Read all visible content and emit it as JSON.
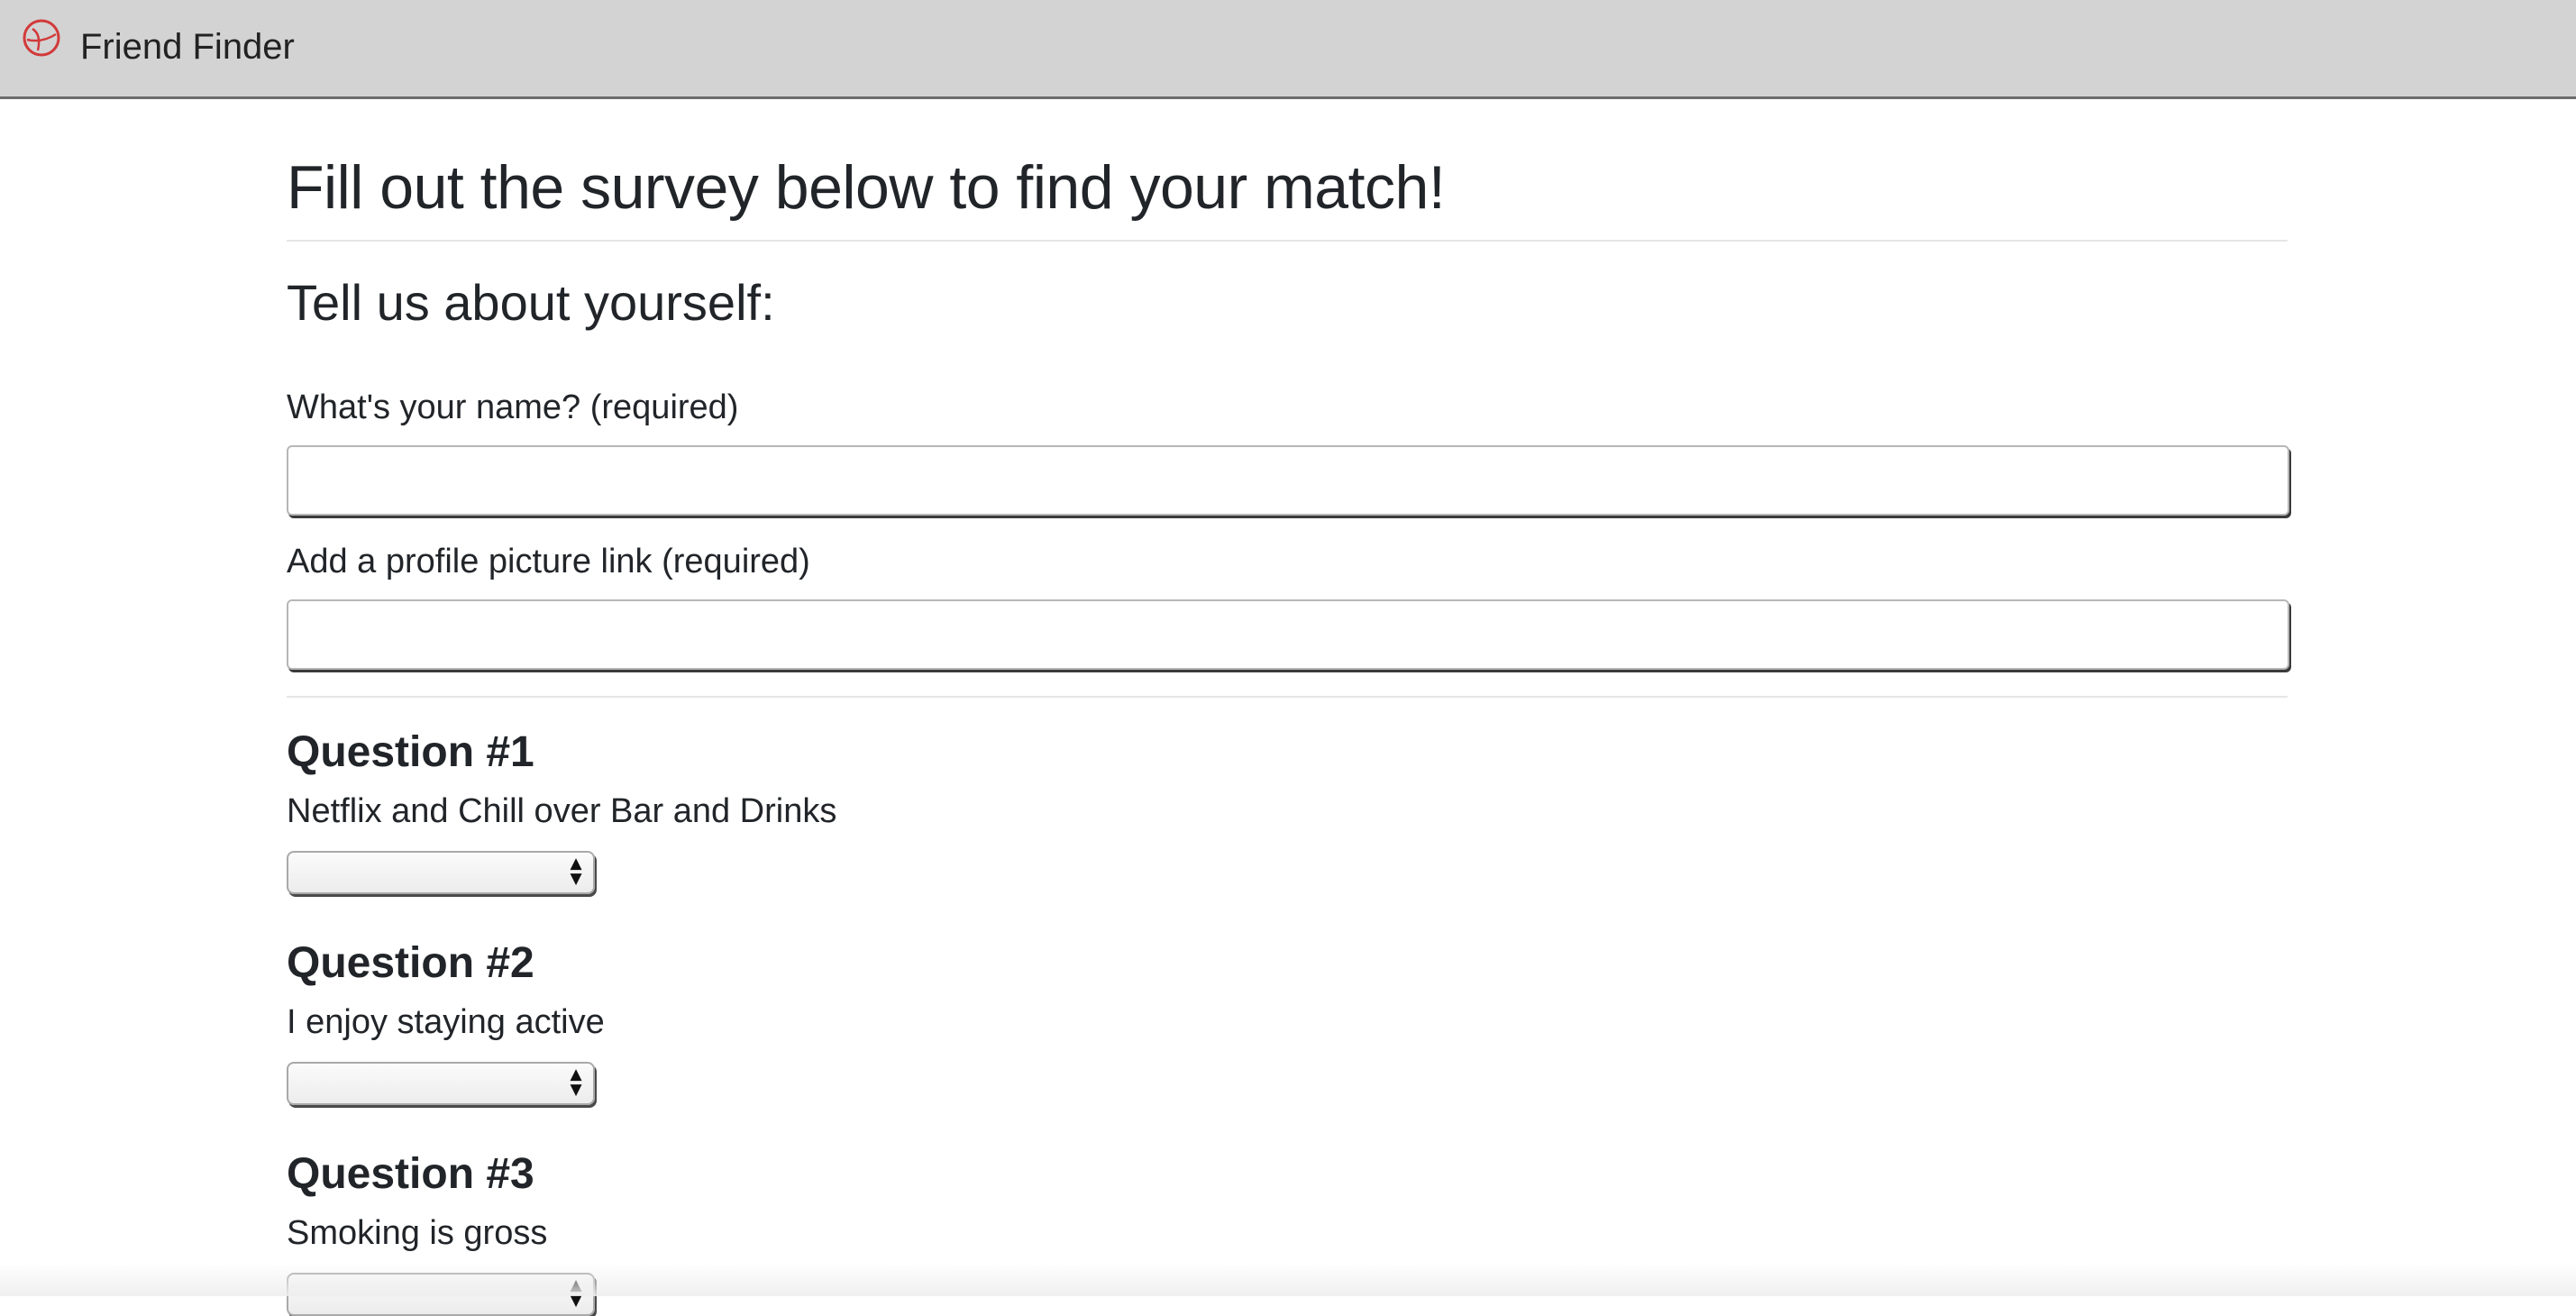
{
  "navbar": {
    "logo_icon": "friend-finder-logo-icon",
    "brand": "Friend Finder",
    "accent": "#d23a3a"
  },
  "main": {
    "title": "Fill out the survey below to find your match!",
    "section_title": "Tell us about yourself:",
    "fields": [
      {
        "label": "What's your name? (required)",
        "value": "",
        "placeholder": ""
      },
      {
        "label": "Add a profile picture link (required)",
        "value": "",
        "placeholder": ""
      }
    ],
    "questions": [
      {
        "title": "Question #1",
        "text": "Netflix and Chill over Bar and Drinks",
        "selected": ""
      },
      {
        "title": "Question #2",
        "text": "I enjoy staying active",
        "selected": ""
      },
      {
        "title": "Question #3",
        "text": "Smoking is gross",
        "selected": ""
      }
    ]
  }
}
